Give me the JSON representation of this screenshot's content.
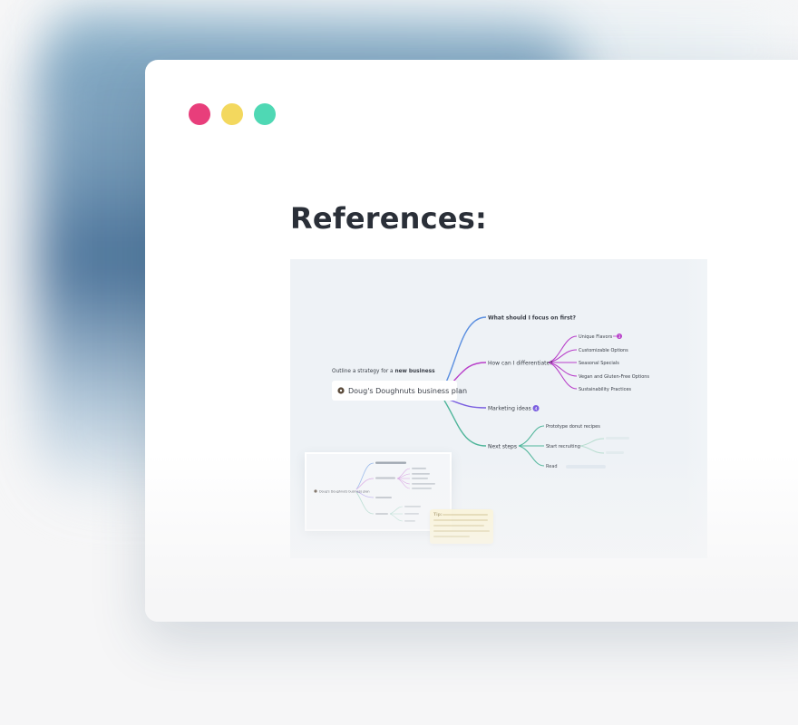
{
  "window": {
    "title_dots": [
      {
        "name": "close",
        "color": "#e83e7b"
      },
      {
        "name": "minimize",
        "color": "#f3d85e"
      },
      {
        "name": "maximize",
        "color": "#4fd8b4"
      }
    ]
  },
  "page": {
    "heading": "References:"
  },
  "mind_map": {
    "prompt_prefix": "Outline a strategy for a ",
    "prompt_bold": "new business",
    "root": {
      "icon": "doughnut-emoji",
      "label": "Doug's Doughnuts business plan"
    },
    "branches": [
      {
        "label": "What should I focus on first?",
        "color": "#5b8fe0",
        "bold": true,
        "children": []
      },
      {
        "label": "How can I differentiate?",
        "color": "#b83fc9",
        "children": [
          {
            "label": "Unique Flavors",
            "badge": "3"
          },
          {
            "label": "Customizable Options"
          },
          {
            "label": "Seasonal Specials"
          },
          {
            "label": "Vegan and Gluten-Free Options"
          },
          {
            "label": "Sustainability Practices"
          }
        ]
      },
      {
        "label": "Marketing ideas",
        "color": "#7b5fe0",
        "badge": "4",
        "children": []
      },
      {
        "label": "Next steps",
        "color": "#4fb59a",
        "children": [
          {
            "label": "Prototype donut recipes"
          },
          {
            "label": "Start recruiting"
          },
          {
            "label": "Read"
          }
        ]
      }
    ]
  },
  "thumbnail": {
    "root_label": "Doug's Doughnuts business plan",
    "tooltip_prefix": "Tip:"
  }
}
